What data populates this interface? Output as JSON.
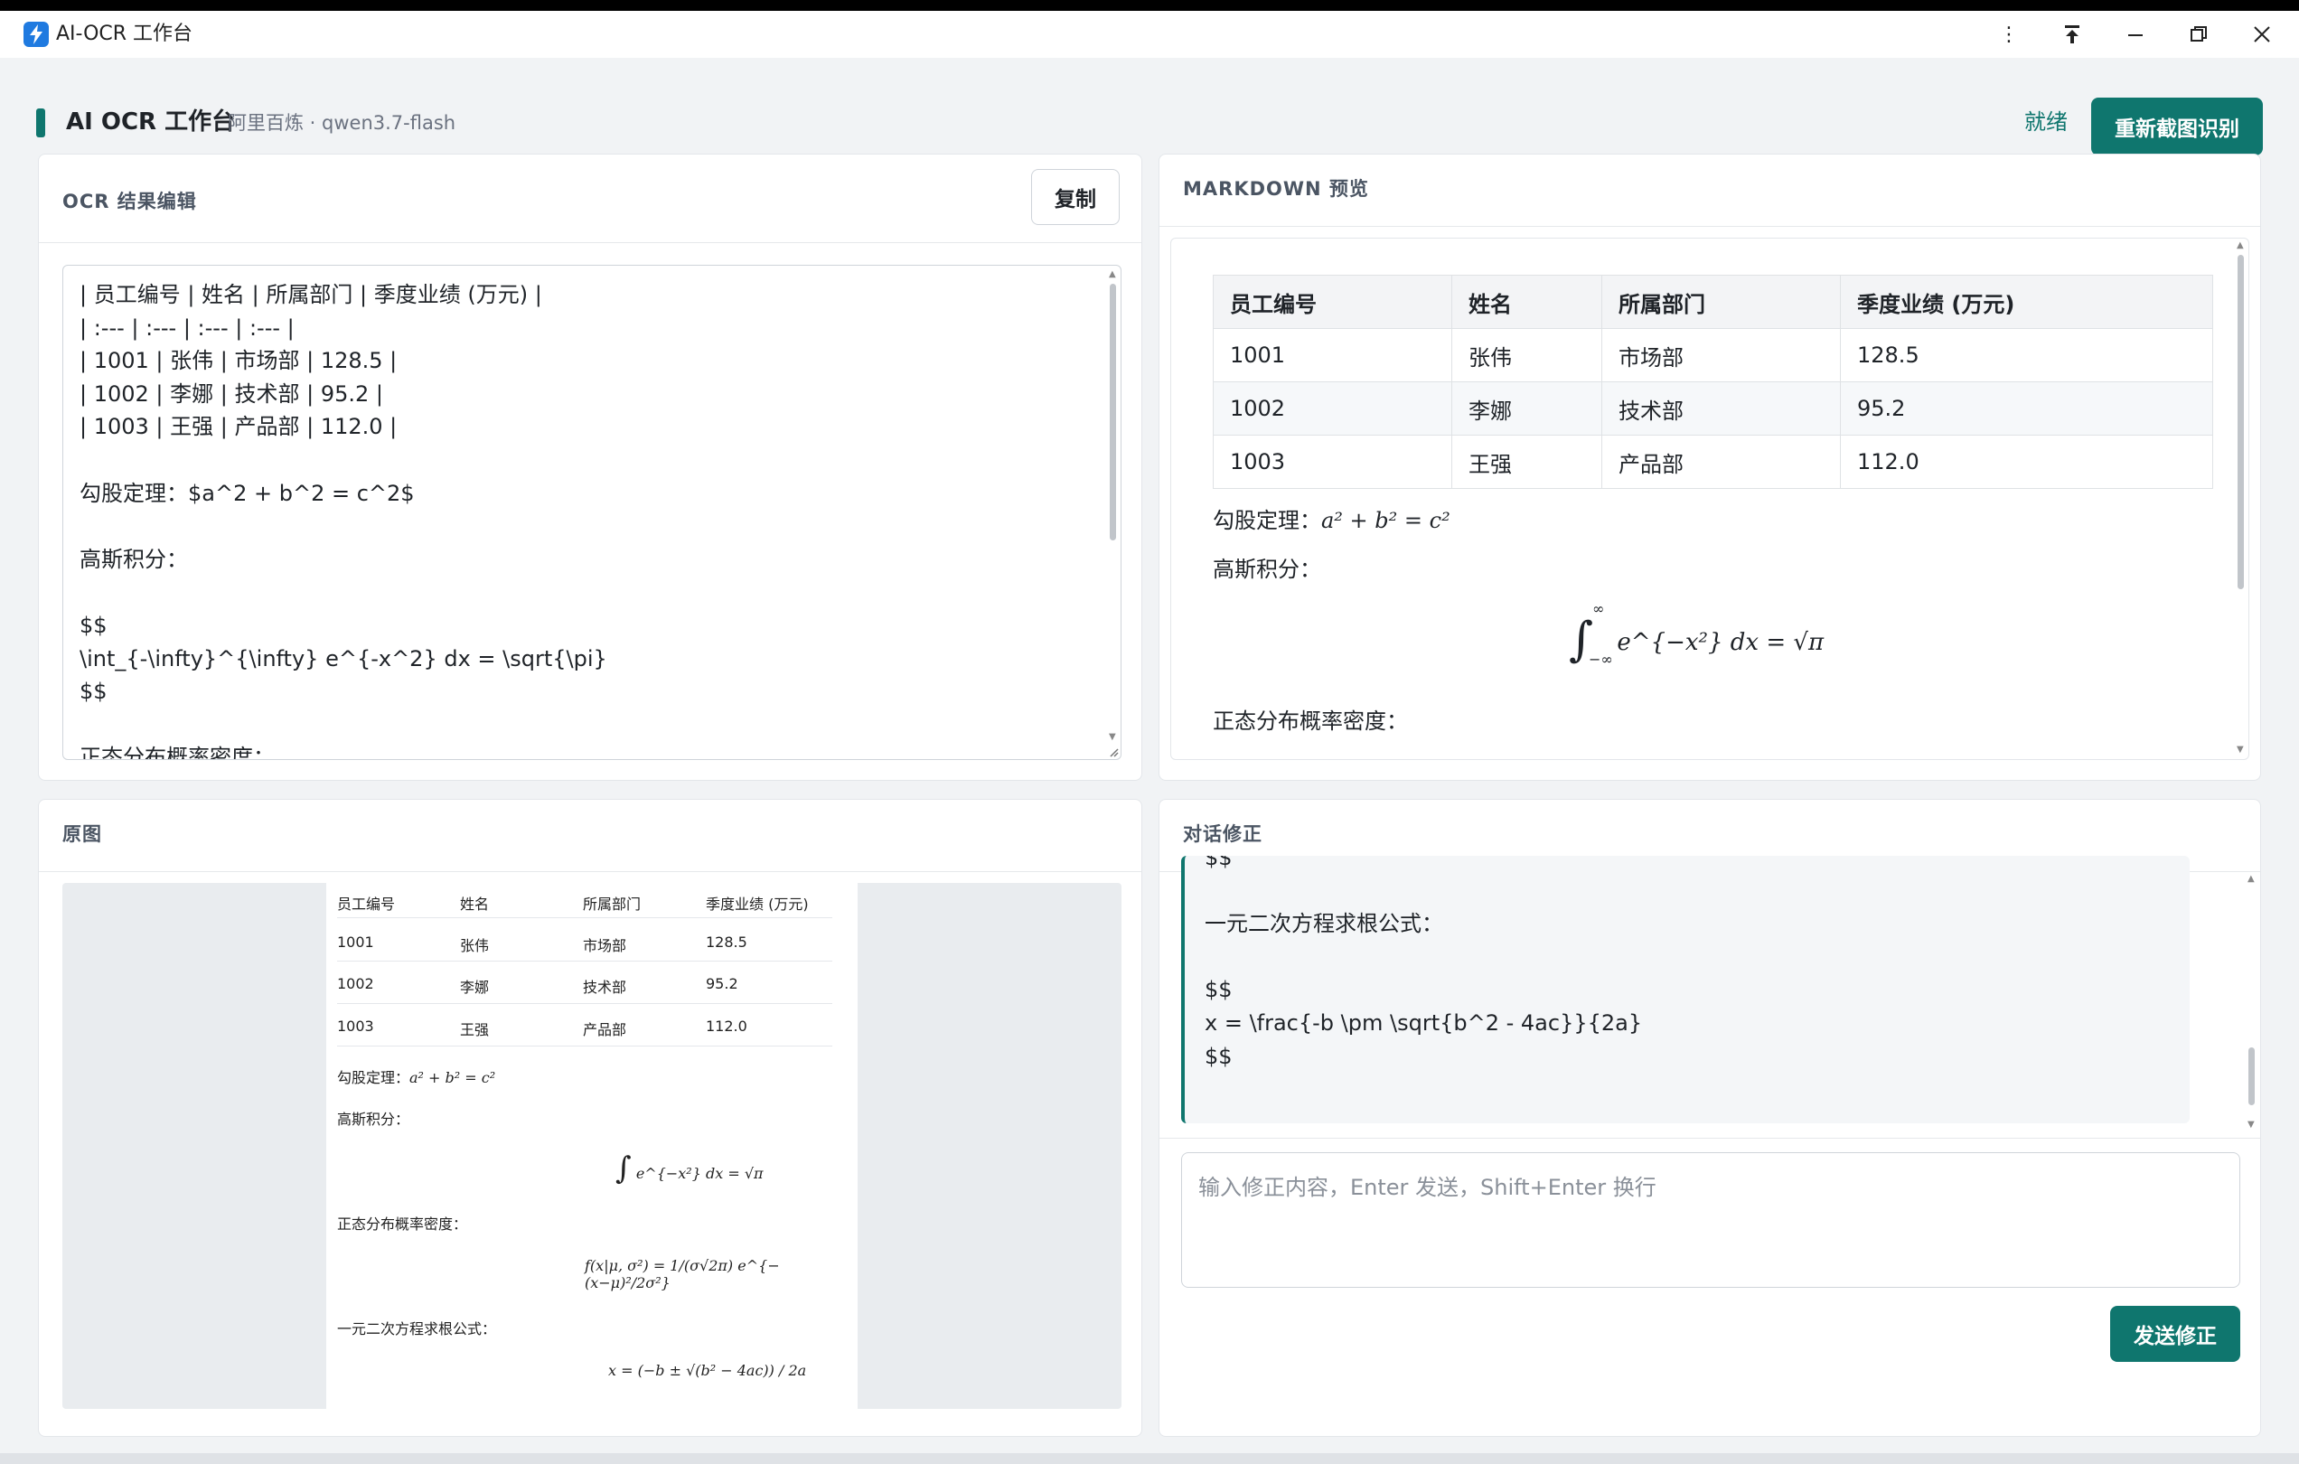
{
  "window": {
    "title": "AI-OCR 工作台",
    "controls": {
      "more": "⋮",
      "pin": "⤒",
      "minimize": "—",
      "maximize": "❐",
      "close": "✕"
    }
  },
  "header": {
    "title": "AI OCR 工作台",
    "subtitle": "阿里百炼 · qwen3.7-flash",
    "status": "就绪",
    "recapture_label": "重新截图识别"
  },
  "editor_panel": {
    "title": "OCR 结果编辑",
    "copy_label": "复制",
    "content": "| 员工编号 | 姓名 | 所属部门 | 季度业绩 (万元) |\n| :--- | :--- | :--- | :--- |\n| 1001 | 张伟 | 市场部 | 128.5 |\n| 1002 | 李娜 | 技术部 | 95.2 |\n| 1003 | 王强 | 产品部 | 112.0 |\n\n勾股定理：$a^2 + b^2 = c^2$\n\n高斯积分：\n\n$$\n\\int_{-\\infty}^{\\infty} e^{-x^2} dx = \\sqrt{\\pi}\n$$\n\n正态分布概率密度："
  },
  "preview_panel": {
    "title": "MARKDOWN 预览",
    "table": {
      "headers": [
        "员工编号",
        "姓名",
        "所属部门",
        "季度业绩 (万元)"
      ],
      "rows": [
        [
          "1001",
          "张伟",
          "市场部",
          "128.5"
        ],
        [
          "1002",
          "李娜",
          "技术部",
          "95.2"
        ],
        [
          "1003",
          "王强",
          "产品部",
          "112.0"
        ]
      ]
    },
    "pythagoras_label": "勾股定理：",
    "pythagoras_formula": "a² + b² = c²",
    "gauss_label": "高斯积分：",
    "gauss_formula": "e^{−x²} dx = √π",
    "normal_label": "正态分布概率密度："
  },
  "original_panel": {
    "title": "原图",
    "table": {
      "headers": [
        "员工编号",
        "姓名",
        "所属部门",
        "季度业绩 (万元)"
      ],
      "rows": [
        [
          "1001",
          "张伟",
          "市场部",
          "128.5"
        ],
        [
          "1002",
          "李娜",
          "技术部",
          "95.2"
        ],
        [
          "1003",
          "王强",
          "产品部",
          "112.0"
        ]
      ]
    },
    "pythagoras_label": "勾股定理：",
    "pythagoras_formula": "a² + b² = c²",
    "gauss_label": "高斯积分：",
    "gauss_formula": "e^{−x²} dx = √π",
    "normal_label": "正态分布概率密度：",
    "normal_formula": "f(x|μ, σ²) = 1/(σ√2π) e^{−(x−μ)²/2σ²}",
    "quadratic_label": "一元二次方程求根公式：",
    "quadratic_formula": "x = (−b ± √(b² − 4ac)) / 2a"
  },
  "chat_panel": {
    "title": "对话修正",
    "message": "$$\n\n一元二次方程求根公式：\n\n$$\nx = \\frac{-b \\pm \\sqrt{b^2 - 4ac}}{2a}\n$$",
    "input_placeholder": "输入修正内容，Enter 发送，Shift+Enter 换行",
    "send_label": "发送修正"
  }
}
